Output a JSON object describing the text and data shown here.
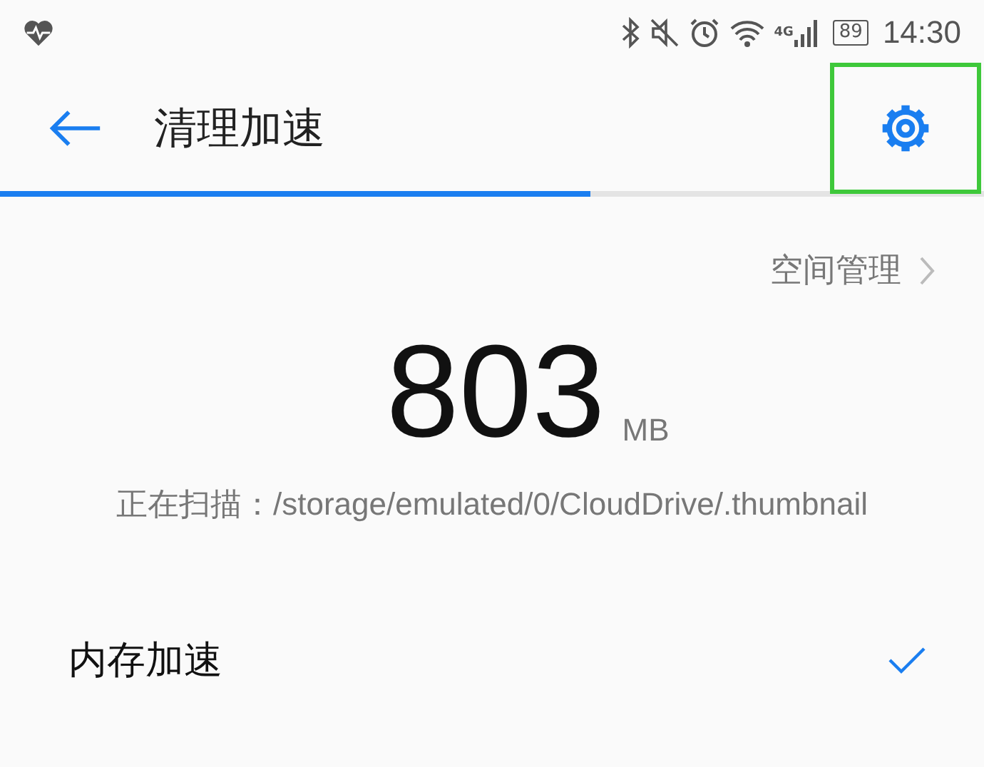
{
  "status_bar": {
    "battery": "89",
    "signal_label": "4G",
    "time": "14:30"
  },
  "header": {
    "title": "清理加速",
    "settings_highlighted": true
  },
  "progress": {
    "level": 0.6
  },
  "space_link": {
    "label": "空间管理"
  },
  "size": {
    "value": "803",
    "unit": "MB"
  },
  "scan_text": "正在扫描：/storage/emulated/0/CloudDrive/.thumbnail",
  "items": [
    {
      "label": "内存加速",
      "checked": true
    }
  ]
}
